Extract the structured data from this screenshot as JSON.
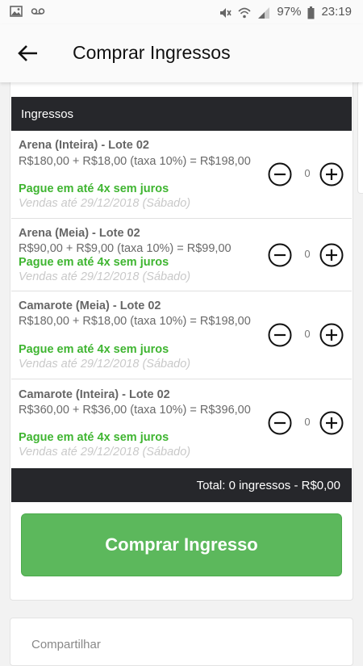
{
  "status_bar": {
    "battery": "97%",
    "time": "23:19"
  },
  "header": {
    "title": "Comprar Ingressos"
  },
  "section": {
    "title": "Ingressos"
  },
  "tickets": [
    {
      "name": "Arena (Inteira) - Lote 02",
      "price": "R$180,00 + R$18,00 (taxa 10%) = R$198,00",
      "promo": "Pague em até 4x sem juros",
      "sales_until": "Vendas até 29/12/2018 (Sábado)",
      "quantity": "0"
    },
    {
      "name": "Arena (Meia) - Lote 02",
      "price": "R$90,00 + R$9,00 (taxa 10%) = R$99,00",
      "promo": "Pague em até 4x sem juros",
      "sales_until": "Vendas até 29/12/2018 (Sábado)",
      "quantity": "0"
    },
    {
      "name": "Camarote (Meia) - Lote 02",
      "price": "R$180,00 + R$18,00 (taxa 10%) = R$198,00",
      "promo": "Pague em até 4x sem juros",
      "sales_until": "Vendas até 29/12/2018 (Sábado)",
      "quantity": "0"
    },
    {
      "name": "Camarote (Inteira) - Lote 02",
      "price": "R$360,00 + R$36,00 (taxa 10%) = R$396,00",
      "promo": "Pague em até 4x sem juros",
      "sales_until": "Vendas até 29/12/2018 (Sábado)",
      "quantity": "0"
    }
  ],
  "total": {
    "text": "Total: 0 ingressos - R$0,00"
  },
  "buy_button": {
    "label": "Comprar Ingresso"
  },
  "share": {
    "label": "Compartilhar"
  },
  "colors": {
    "accent_green": "#5cb85c",
    "promo_green": "#3fb531",
    "header_dark": "#26272b"
  }
}
